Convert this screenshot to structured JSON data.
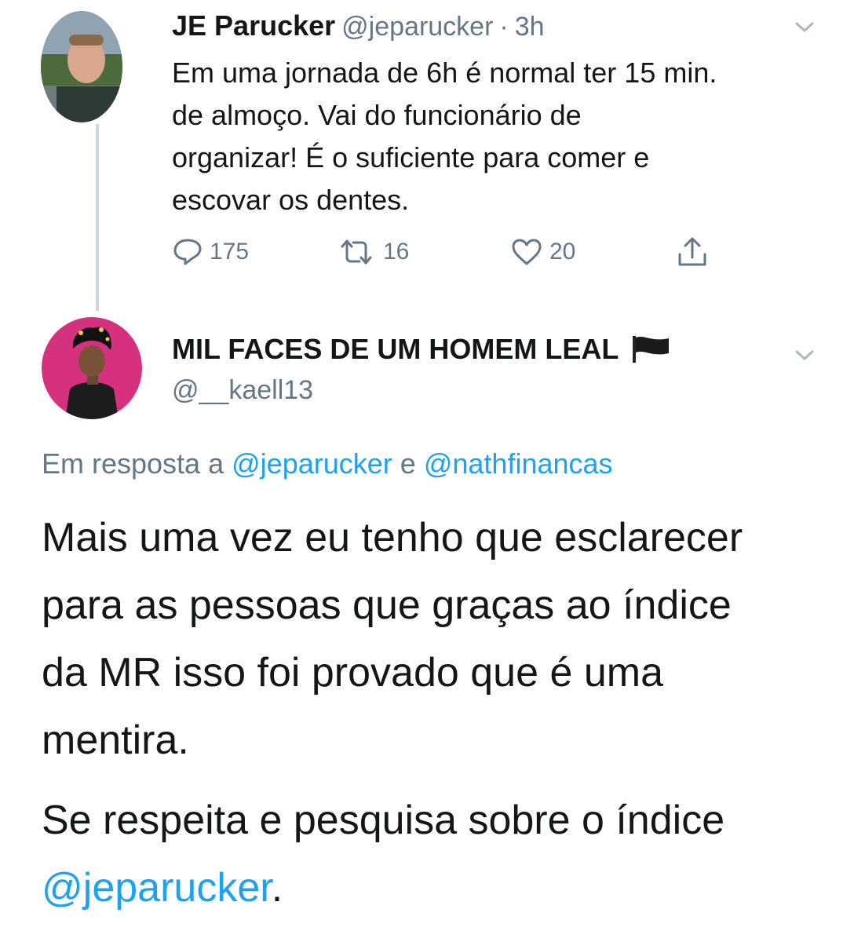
{
  "tweet1": {
    "author_name": "JE Parucker",
    "author_handle": "@jeparucker",
    "separator": "·",
    "time": "3h",
    "text_lines": [
      "Em uma jornada de 6h é normal ter 15 min.",
      "de almoço. Vai do funcionário de",
      "organizar! É o suficiente para comer e",
      "escovar os dentes."
    ],
    "replies": "175",
    "retweets": "16",
    "likes": "20"
  },
  "tweet2": {
    "author_name": "MIL FACES DE UM HOMEM LEAL",
    "flag_emoji": "black-flag",
    "author_handle": "@__kaell13",
    "reply_prefix": "Em resposta a",
    "reply_user1": "@jeparucker",
    "reply_conj": "e",
    "reply_user2": "@nathfinancas",
    "paragraph1_lines": [
      "Mais uma vez eu tenho que esclarecer",
      "para as pessoas que graças ao índice",
      "da MR isso foi provado que é uma",
      "mentira."
    ],
    "paragraph2_line1": "Se respeita e pesquisa sobre o índice",
    "paragraph2_mention": "@jeparucker",
    "paragraph2_end": "."
  },
  "colors": {
    "accent": "#1da1f2",
    "secondary_text": "#657786",
    "avatar2_bg": "#d6317e"
  }
}
